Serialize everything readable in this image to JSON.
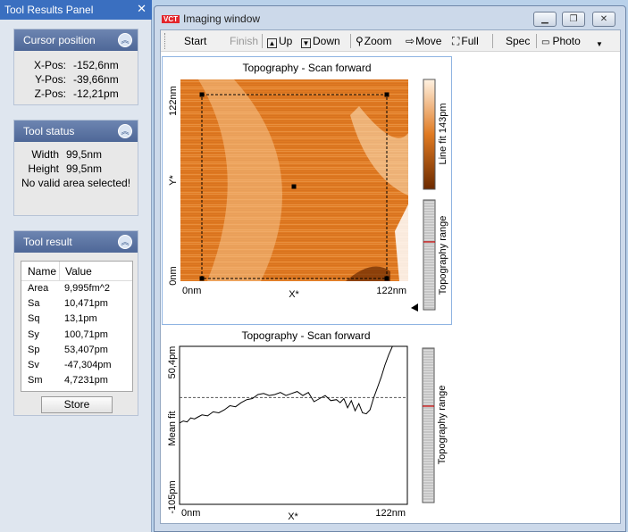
{
  "left_panel": {
    "title": "Tool Results Panel",
    "cursor": {
      "title": "Cursor position",
      "rows": [
        {
          "k": "X-Pos:",
          "v": "-152,6nm"
        },
        {
          "k": "Y-Pos:",
          "v": "-39,66nm"
        },
        {
          "k": "Z-Pos:",
          "v": "-12,21pm"
        }
      ]
    },
    "status": {
      "title": "Tool status",
      "rows": [
        {
          "k": "Width",
          "v": "99,5nm"
        },
        {
          "k": "Height",
          "v": "99,5nm"
        }
      ],
      "message": "No valid area selected!"
    },
    "result": {
      "title": "Tool result",
      "headers": [
        "Name",
        "Value"
      ],
      "rows": [
        [
          "Area",
          "9,995fm^2"
        ],
        [
          "Sa",
          "10,471pm"
        ],
        [
          "Sq",
          "13,1pm"
        ],
        [
          "Sy",
          "100,71pm"
        ],
        [
          "Sp",
          "53,407pm"
        ],
        [
          "Sv",
          "-47,304pm"
        ],
        [
          "Sm",
          "4,7231pm"
        ]
      ],
      "store": "Store"
    }
  },
  "window": {
    "title": "Imaging window",
    "logo": "VCT",
    "toolbar": {
      "start": "Start",
      "finish": "Finish",
      "up": "Up",
      "down": "Down",
      "zoom": "Zoom",
      "move": "Move",
      "full": "Full",
      "spec": "Spec",
      "photo": "Photo"
    }
  },
  "topography_image": {
    "title": "Topography - Scan forward",
    "x_start": "0nm",
    "x_end": "122nm",
    "x_label": "X*",
    "y_top": "122nm",
    "y_bottom": "0nm",
    "y_label": "Y*",
    "colorbar_label": "Line fit 143pm",
    "range_label": "Topography range",
    "colors": {
      "low": "#6b2a00",
      "mid": "#e07a22",
      "high": "#fff2e2"
    }
  },
  "chart_data": {
    "type": "line",
    "title": "Topography - Scan forward",
    "xlabel": "X*",
    "ylabel": "Mean fit",
    "x_tick_labels": [
      "0nm",
      "122nm"
    ],
    "y_tick_labels": [
      "50,4pm",
      "-105pm"
    ],
    "xlim": [
      0,
      122
    ],
    "ylim": [
      -105,
      50.4
    ],
    "reference_line": 0,
    "range_label": "Topography range",
    "series": [
      {
        "x": [
          0,
          2,
          4,
          6,
          8,
          10,
          12,
          15,
          18,
          21,
          24,
          27,
          30,
          33,
          36,
          39,
          42,
          45,
          48,
          51,
          54,
          57,
          60,
          63,
          66,
          69,
          72,
          75,
          78,
          81,
          84,
          86,
          88,
          90,
          92,
          94,
          96,
          98,
          100,
          102,
          104,
          106,
          108,
          110,
          112,
          114,
          116,
          118,
          120,
          122
        ],
        "y": [
          -25,
          -23,
          -24,
          -20,
          -21,
          -19,
          -17,
          -18,
          -14,
          -15,
          -12,
          -8,
          -9,
          -5,
          -2,
          -1,
          3,
          4,
          2,
          3,
          5,
          2,
          4,
          6,
          2,
          5,
          -4,
          -1,
          2,
          -3,
          -2,
          -5,
          -1,
          -10,
          -3,
          -13,
          -6,
          -15,
          -16,
          -12,
          0,
          10,
          20,
          32,
          42,
          50.4,
          50.4,
          50.4,
          50.4,
          50.4
        ]
      }
    ]
  }
}
